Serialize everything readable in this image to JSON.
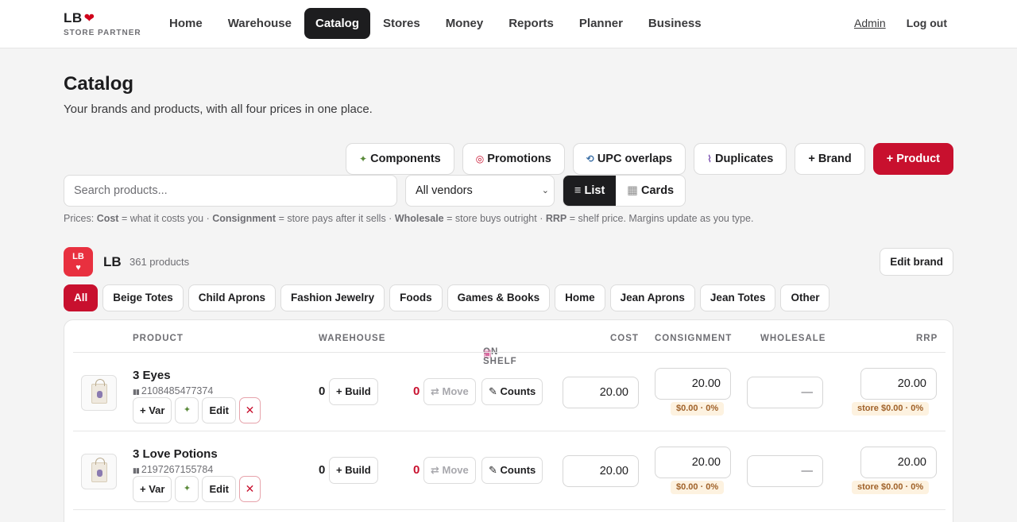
{
  "brand": {
    "name": "LB",
    "tagline": "STORE PARTNER"
  },
  "nav": {
    "items": [
      "Home",
      "Warehouse",
      "Catalog",
      "Stores",
      "Money",
      "Reports",
      "Planner",
      "Business"
    ],
    "active": "Catalog",
    "admin": "Admin",
    "logout": "Log out"
  },
  "page": {
    "title": "Catalog",
    "subtitle": "Your brands and products, with all four prices in one place."
  },
  "actions": {
    "components": "Components",
    "promotions": "Promotions",
    "upc_overlaps": "UPC overlaps",
    "duplicates": "Duplicates",
    "add_brand": "+ Brand",
    "add_product": "+ Product"
  },
  "filters": {
    "search_placeholder": "Search products...",
    "vendor_selected": "All vendors",
    "view_list": "List",
    "view_cards": "Cards"
  },
  "prices_note": {
    "prefix": "Prices: ",
    "cost_label": "Cost",
    "cost_desc": " = what it costs you · ",
    "consignment_label": "Consignment",
    "consignment_desc": " = store pays after it sells · ",
    "wholesale_label": "Wholesale",
    "wholesale_desc": " = store buys outright · ",
    "rrp_label": "RRP",
    "rrp_desc": " = shelf price. Margins update as you type."
  },
  "brand_section": {
    "logo_text": "LB",
    "name": "LB",
    "count": "361 products",
    "edit_label": "Edit brand",
    "categories": [
      "All",
      "Beige Totes",
      "Child Aprons",
      "Fashion Jewelry",
      "Foods",
      "Games & Books",
      "Home",
      "Jean Aprons",
      "Jean Totes",
      "Other"
    ],
    "active_category": "All"
  },
  "table": {
    "headers": {
      "product": "PRODUCT",
      "warehouse": "WAREHOUSE",
      "on_shelf": "ON SHELF",
      "cost": "COST",
      "consignment": "CONSIGNMENT",
      "wholesale": "WHOLESALE",
      "rrp": "RRP"
    },
    "rows": [
      {
        "name": "3 Eyes",
        "upc": "2108485477374",
        "warehouse": "0",
        "on_shelf": "0",
        "cost": "20.00",
        "consignment": "20.00",
        "consignment_margin": "$0.00 · 0%",
        "wholesale": "—",
        "rrp": "20.00",
        "rrp_margin": "store $0.00 · 0%"
      },
      {
        "name": "3 Love Potions",
        "upc": "2197267155784",
        "warehouse": "0",
        "on_shelf": "0",
        "cost": "20.00",
        "consignment": "20.00",
        "consignment_margin": "$0.00 · 0%",
        "wholesale": "—",
        "rrp": "20.00",
        "rrp_margin": "store $0.00 · 0%"
      }
    ],
    "row_buttons": {
      "var": "+ Var",
      "edit": "Edit",
      "build": "+ Build",
      "move": "Move",
      "counts": "Counts"
    }
  },
  "colors": {
    "accent": "#c8102e",
    "dark": "#1d1d1f",
    "margin_pill_bg": "#fdf2e0"
  }
}
